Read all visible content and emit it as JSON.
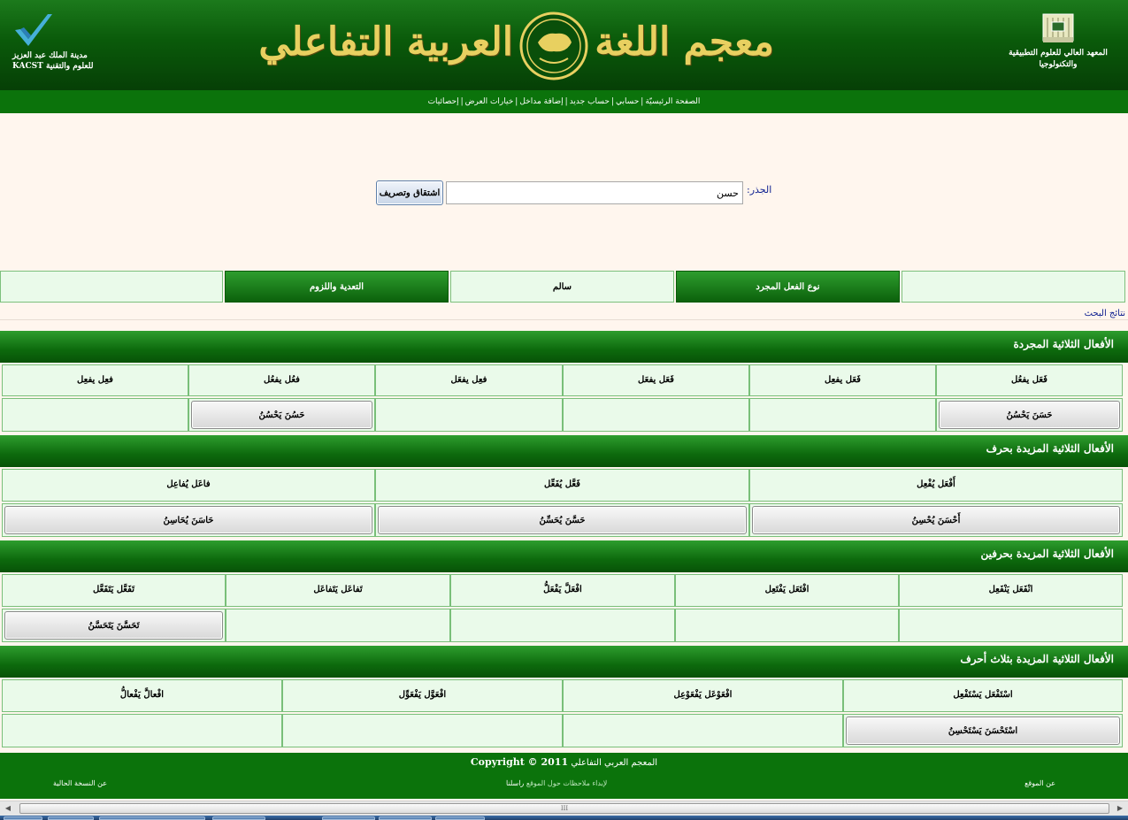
{
  "header": {
    "title_right": "معجم اللغة",
    "title_left": "العربية التفاعلي",
    "left_org_line1": "مدينة الملك عبد العزيز",
    "left_org_line2": "للعلوم والتقنية KACST",
    "right_org_line1": "المعهد العالي للعلوم التطبيقية",
    "right_org_line2": "والتكنولوجيا",
    "colors": {
      "header_green": "#0a5a0a",
      "title_gold": "#e8d060"
    }
  },
  "nav": {
    "items": [
      "الصفحة الرئيسيّة",
      "حسابي",
      "حساب جديد",
      "إضافة مداخل",
      "خيارات العرض",
      "إحصائيات"
    ],
    "separator": "|"
  },
  "search": {
    "root_label": "الجذر:",
    "root_value": "حسن",
    "submit_label": "اشتقاق وتصريف"
  },
  "filters": [
    {
      "label": "",
      "style": "light"
    },
    {
      "label": "نوع الفعل المجرد",
      "style": "dark"
    },
    {
      "label": "سالم",
      "style": "light"
    },
    {
      "label": "التعدية واللزوم",
      "style": "dark"
    },
    {
      "label": "",
      "style": "light"
    }
  ],
  "results_label": "نتائج البحث",
  "sections": [
    {
      "title": "الأفعال الثلاثية المجردة",
      "cols": 6,
      "patterns": [
        "فَعَل يفعُل",
        "فَعَل يفعِل",
        "فَعَل يفعَل",
        "فعِل يفعَل",
        "فعُل يفعُل",
        "فعِل يفعِل"
      ],
      "verbs": [
        "حَسَنَ يَحْسُنُ",
        "",
        "",
        "",
        "حَسُنَ يَحْسُنُ",
        ""
      ]
    },
    {
      "title": "الأفعال الثلاثية المزيدة بحرف",
      "cols": 3,
      "patterns": [
        "أَفْعَل يُفْعِل",
        "فَعَّل يُفَعِّل",
        "فاعَل يُفاعِل"
      ],
      "verbs": [
        "أَحْسَنَ يُحْسِنُ",
        "حَسَّنَ يُحَسِّنُ",
        "حَاسَنَ يُحَاسِنُ"
      ]
    },
    {
      "title": "الأفعال الثلاثية المزيدة بحرفين",
      "cols": 5,
      "patterns": [
        "انْفَعَل يَنْفَعِل",
        "افْتَعَل يَفْتَعِل",
        "افْعَلَّ يَفْعَلُّ",
        "تَفاعَل يَتَفاعَل",
        "تَفَعَّل يَتَفَعَّل"
      ],
      "verbs": [
        "",
        "",
        "",
        "",
        "تَحَسَّنَ يَتَحَسَّنُ"
      ]
    },
    {
      "title": "الأفعال الثلاثية المزيدة بثلاث أحرف",
      "cols": 4,
      "patterns": [
        "اسْتَفْعَل يَسْتَفْعِل",
        "افْعَوْعَل يَفْعَوْعِل",
        "افْعَوَّل يَفْعَوِّل",
        "افْعالَّ يَفْعالُّ"
      ],
      "verbs": [
        "اسْتَحْسَنَ يَسْتَحْسِنُ",
        "",
        "",
        ""
      ]
    }
  ],
  "footer": {
    "title": "المعجم العربي التفاعلي",
    "copyright": "Copyright © 2011",
    "about_site": "عن الموقع",
    "current_version": "عن النسخة الحالية",
    "feedback_prefix": "لإبداء ملاحظات حول الموقع",
    "contact": "راسلنا"
  },
  "scrollbar": {
    "thumb_grip": "III"
  }
}
